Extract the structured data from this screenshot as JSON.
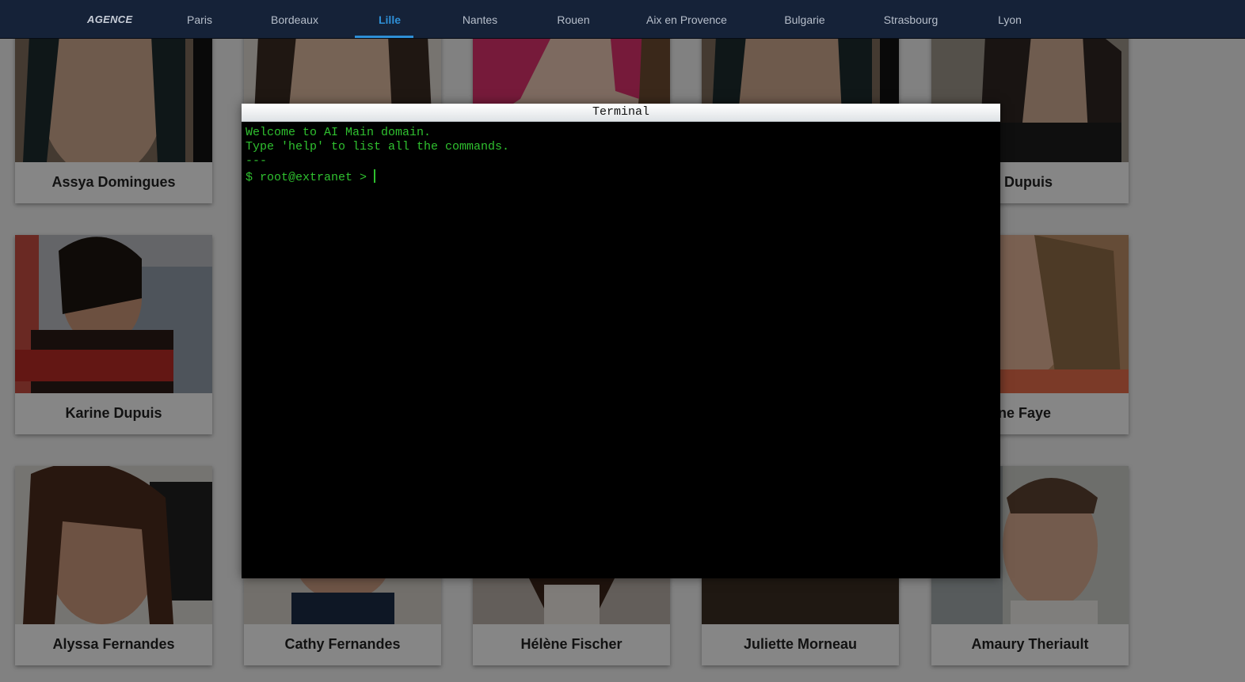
{
  "nav": {
    "brand": "AGENCE",
    "items": [
      {
        "label": "Paris"
      },
      {
        "label": "Bordeaux"
      },
      {
        "label": "Lille",
        "active": true
      },
      {
        "label": "Nantes"
      },
      {
        "label": "Rouen"
      },
      {
        "label": "Aix en Provence"
      },
      {
        "label": "Bulgarie"
      },
      {
        "label": "Strasbourg"
      },
      {
        "label": "Lyon"
      }
    ],
    "accent_color": "#2e8fd6"
  },
  "people": {
    "row1": [
      {
        "name": "Assya Domingues"
      },
      {
        "name": ""
      },
      {
        "name": ""
      },
      {
        "name": ""
      },
      {
        "name": "elys Dupuis"
      }
    ],
    "row2": [
      {
        "name": "Karine Dupuis"
      },
      {
        "name": "vonne Faye"
      }
    ],
    "row3": [
      {
        "name": "Alyssa Fernandes"
      },
      {
        "name": "Cathy Fernandes"
      },
      {
        "name": "Hélène Fischer"
      },
      {
        "name": "Juliette Morneau"
      },
      {
        "name": "Amaury Theriault"
      }
    ]
  },
  "terminal": {
    "title": "Terminal",
    "lines": [
      "Welcome to AI Main domain.",
      "Type 'help' to list all the commands.",
      "---"
    ],
    "prompt": "$ root@extranet > ",
    "input_value": "",
    "text_color": "#2fc02f"
  }
}
